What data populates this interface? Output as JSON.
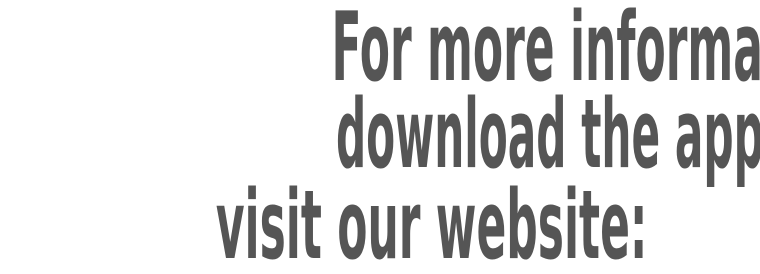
{
  "message": {
    "line1": "For more information or to",
    "line2": "download the application,",
    "line3": "visit our website:"
  },
  "colors": {
    "text": "#555555",
    "background": "#ffffff"
  }
}
